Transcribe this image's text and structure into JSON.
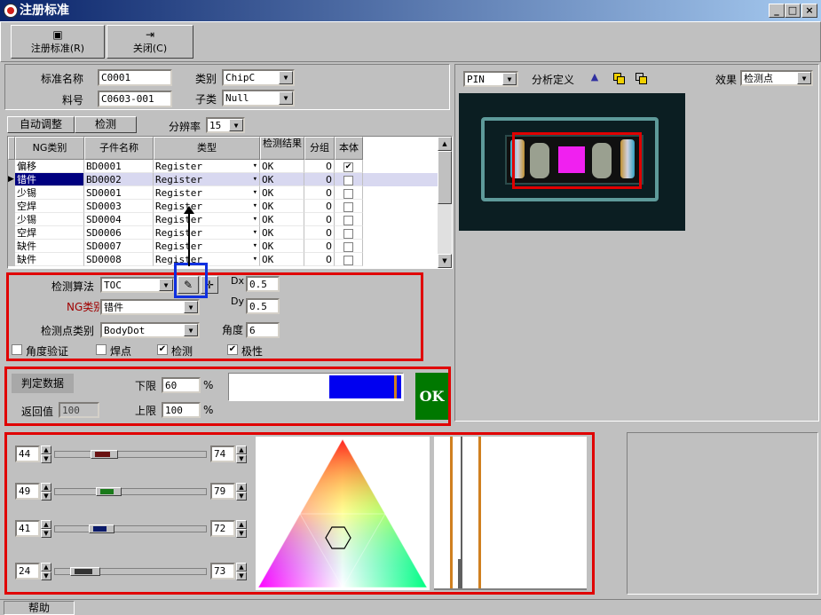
{
  "window": {
    "title": "注册标准"
  },
  "toolbar": {
    "register_label": "注册标准(R)",
    "close_label": "关闭(C)"
  },
  "form": {
    "std_name_label": "标准名称",
    "std_name_value": "C0001",
    "part_no_label": "料号",
    "part_no_value": "C0603-001",
    "category_label": "类别",
    "category_value": "ChipC",
    "subcategory_label": "子类",
    "subcategory_value": "Null"
  },
  "controls": {
    "auto_adjust_label": "自动调整",
    "detect_label": "检测",
    "resolution_label": "分辨率",
    "resolution_value": "15"
  },
  "grid": {
    "headers": [
      "NG类别",
      "子件名称",
      "类型",
      "检测结果",
      "分组",
      "本体"
    ],
    "rows": [
      {
        "ng": "偏移",
        "name": "BD0001",
        "type": "Register",
        "result": "OK",
        "group": "0",
        "body": true
      },
      {
        "ng": "错件",
        "name": "BD0002",
        "type": "Register",
        "result": "OK",
        "group": "0",
        "body": false
      },
      {
        "ng": "少锡",
        "name": "SD0001",
        "type": "Register",
        "result": "OK",
        "group": "0",
        "body": false
      },
      {
        "ng": "空焊",
        "name": "SD0003",
        "type": "Register",
        "result": "OK",
        "group": "0",
        "body": false
      },
      {
        "ng": "少锡",
        "name": "SD0004",
        "type": "Register",
        "result": "OK",
        "group": "0",
        "body": false
      },
      {
        "ng": "空焊",
        "name": "SD0006",
        "type": "Register",
        "result": "OK",
        "group": "0",
        "body": false
      },
      {
        "ng": "缺件",
        "name": "SD0007",
        "type": "Register",
        "result": "OK",
        "group": "0",
        "body": false
      },
      {
        "ng": "缺件",
        "name": "SD0008",
        "type": "Register",
        "result": "OK",
        "group": "0",
        "body": false
      }
    ]
  },
  "algo": {
    "method_label": "检测算法",
    "method_value": "TOC",
    "ng_label": "NG类别",
    "ng_value": "错件",
    "point_label": "检测点类别",
    "point_value": "BodyDot",
    "dx_label": "Dx",
    "dx_value": "0.5",
    "dy_label": "Dy",
    "dy_value": "0.5",
    "angle_label": "角度",
    "angle_value": "6",
    "cb_angle": {
      "label": "角度验证",
      "checked": false
    },
    "cb_solder": {
      "label": "焊点",
      "checked": false
    },
    "cb_detect": {
      "label": "检测",
      "checked": true
    },
    "cb_polarity": {
      "label": "极性",
      "checked": true
    }
  },
  "judge": {
    "title": "判定数据",
    "return_label": "返回值",
    "return_value": "100",
    "lower_label": "下限",
    "lower_value": "60",
    "upper_label": "上限",
    "upper_value": "100",
    "percent": "%",
    "ok_label": "OK",
    "bar_level": 0.69
  },
  "preview": {
    "pin_value": "PIN",
    "analysis_label": "分析定义",
    "effect_label": "效果",
    "effect_value": "检测点"
  },
  "sliders": [
    {
      "low": "44",
      "high": "74",
      "color": "#6a1212",
      "from": 0.23,
      "to": 0.41
    },
    {
      "low": "49",
      "high": "79",
      "color": "#1a7a1a",
      "from": 0.27,
      "to": 0.44
    },
    {
      "low": "41",
      "high": "72",
      "color": "#0a1a6a",
      "from": 0.22,
      "to": 0.39
    },
    {
      "low": "24",
      "high": "73",
      "color": "#333333",
      "from": 0.1,
      "to": 0.3
    }
  ],
  "status": {
    "help_label": "帮助"
  }
}
